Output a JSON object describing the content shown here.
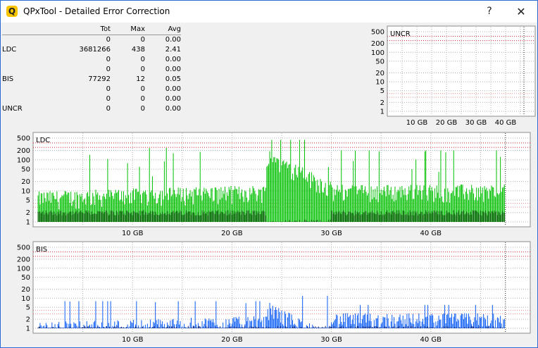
{
  "window": {
    "title": "QPxTool - Detailed Error Correction",
    "help_label": "?",
    "close_label": "✕",
    "icon_letter": "Q"
  },
  "stats": {
    "headers": [
      "",
      "Tot",
      "Max",
      "Avg"
    ],
    "rows": [
      [
        "",
        "0",
        "0",
        "0.00"
      ],
      [
        "LDC",
        "3681266",
        "438",
        "2.41"
      ],
      [
        "",
        "0",
        "0",
        "0.00"
      ],
      [
        "",
        "0",
        "0",
        "0.00"
      ],
      [
        "BIS",
        "77292",
        "12",
        "0.05"
      ],
      [
        "",
        "0",
        "0",
        "0.00"
      ],
      [
        "",
        "0",
        "0",
        "0.00"
      ],
      [
        "UNCR",
        "0",
        "0",
        "0.00"
      ]
    ]
  },
  "chart_data": [
    {
      "type": "area",
      "name": "UNCR",
      "title": "UNCR",
      "yscale": "log",
      "yticks": [
        "500",
        "200",
        "100",
        "50",
        "20",
        "10",
        "5",
        "2",
        "1"
      ],
      "xticks": [
        "10 GB",
        "20 GB",
        "30 GB",
        "40 GB"
      ],
      "xlim": [
        0,
        50
      ],
      "max_value": 0,
      "colors": {
        "series": "#00aa00"
      }
    },
    {
      "type": "area",
      "name": "LDC",
      "title": "LDC",
      "yscale": "log",
      "yticks": [
        "500",
        "200",
        "100",
        "50",
        "20",
        "10",
        "5",
        "2",
        "1"
      ],
      "xticks": [
        "10 GB",
        "20 GB",
        "30 GB",
        "40 GB"
      ],
      "xlim": [
        0,
        50
      ],
      "max_value": 438,
      "regions": [
        {
          "x": [
            0.5,
            23.5
          ],
          "typical_peak": 6,
          "base": 2,
          "spike_max": 300
        },
        {
          "x": [
            23.5,
            30
          ],
          "typical_peak": 150,
          "base": 1,
          "spike_max": 438
        },
        {
          "x": [
            30,
            47.5
          ],
          "typical_peak": 10,
          "base": 2,
          "spike_max": 200
        }
      ],
      "colors": {
        "light": "#00c000",
        "dark": "#006000"
      }
    },
    {
      "type": "area",
      "name": "BIS",
      "title": "BIS",
      "yscale": "log",
      "yticks": [
        "500",
        "200",
        "100",
        "50",
        "20",
        "10",
        "5",
        "2",
        "1"
      ],
      "xticks": [
        "10 GB",
        "20 GB",
        "30 GB",
        "40 GB"
      ],
      "xlim": [
        0,
        50
      ],
      "max_value": 12,
      "regions": [
        {
          "x": [
            0.5,
            23.5
          ],
          "typical_peak": 1,
          "base": 1,
          "spike_max": 8
        },
        {
          "x": [
            23.5,
            30
          ],
          "typical_peak": 5,
          "base": 1,
          "spike_max": 12
        },
        {
          "x": [
            30,
            47.5
          ],
          "typical_peak": 2,
          "base": 1,
          "spike_max": 6
        }
      ],
      "colors": {
        "light": "#0a5cf5",
        "dark": "#001f80"
      }
    }
  ]
}
